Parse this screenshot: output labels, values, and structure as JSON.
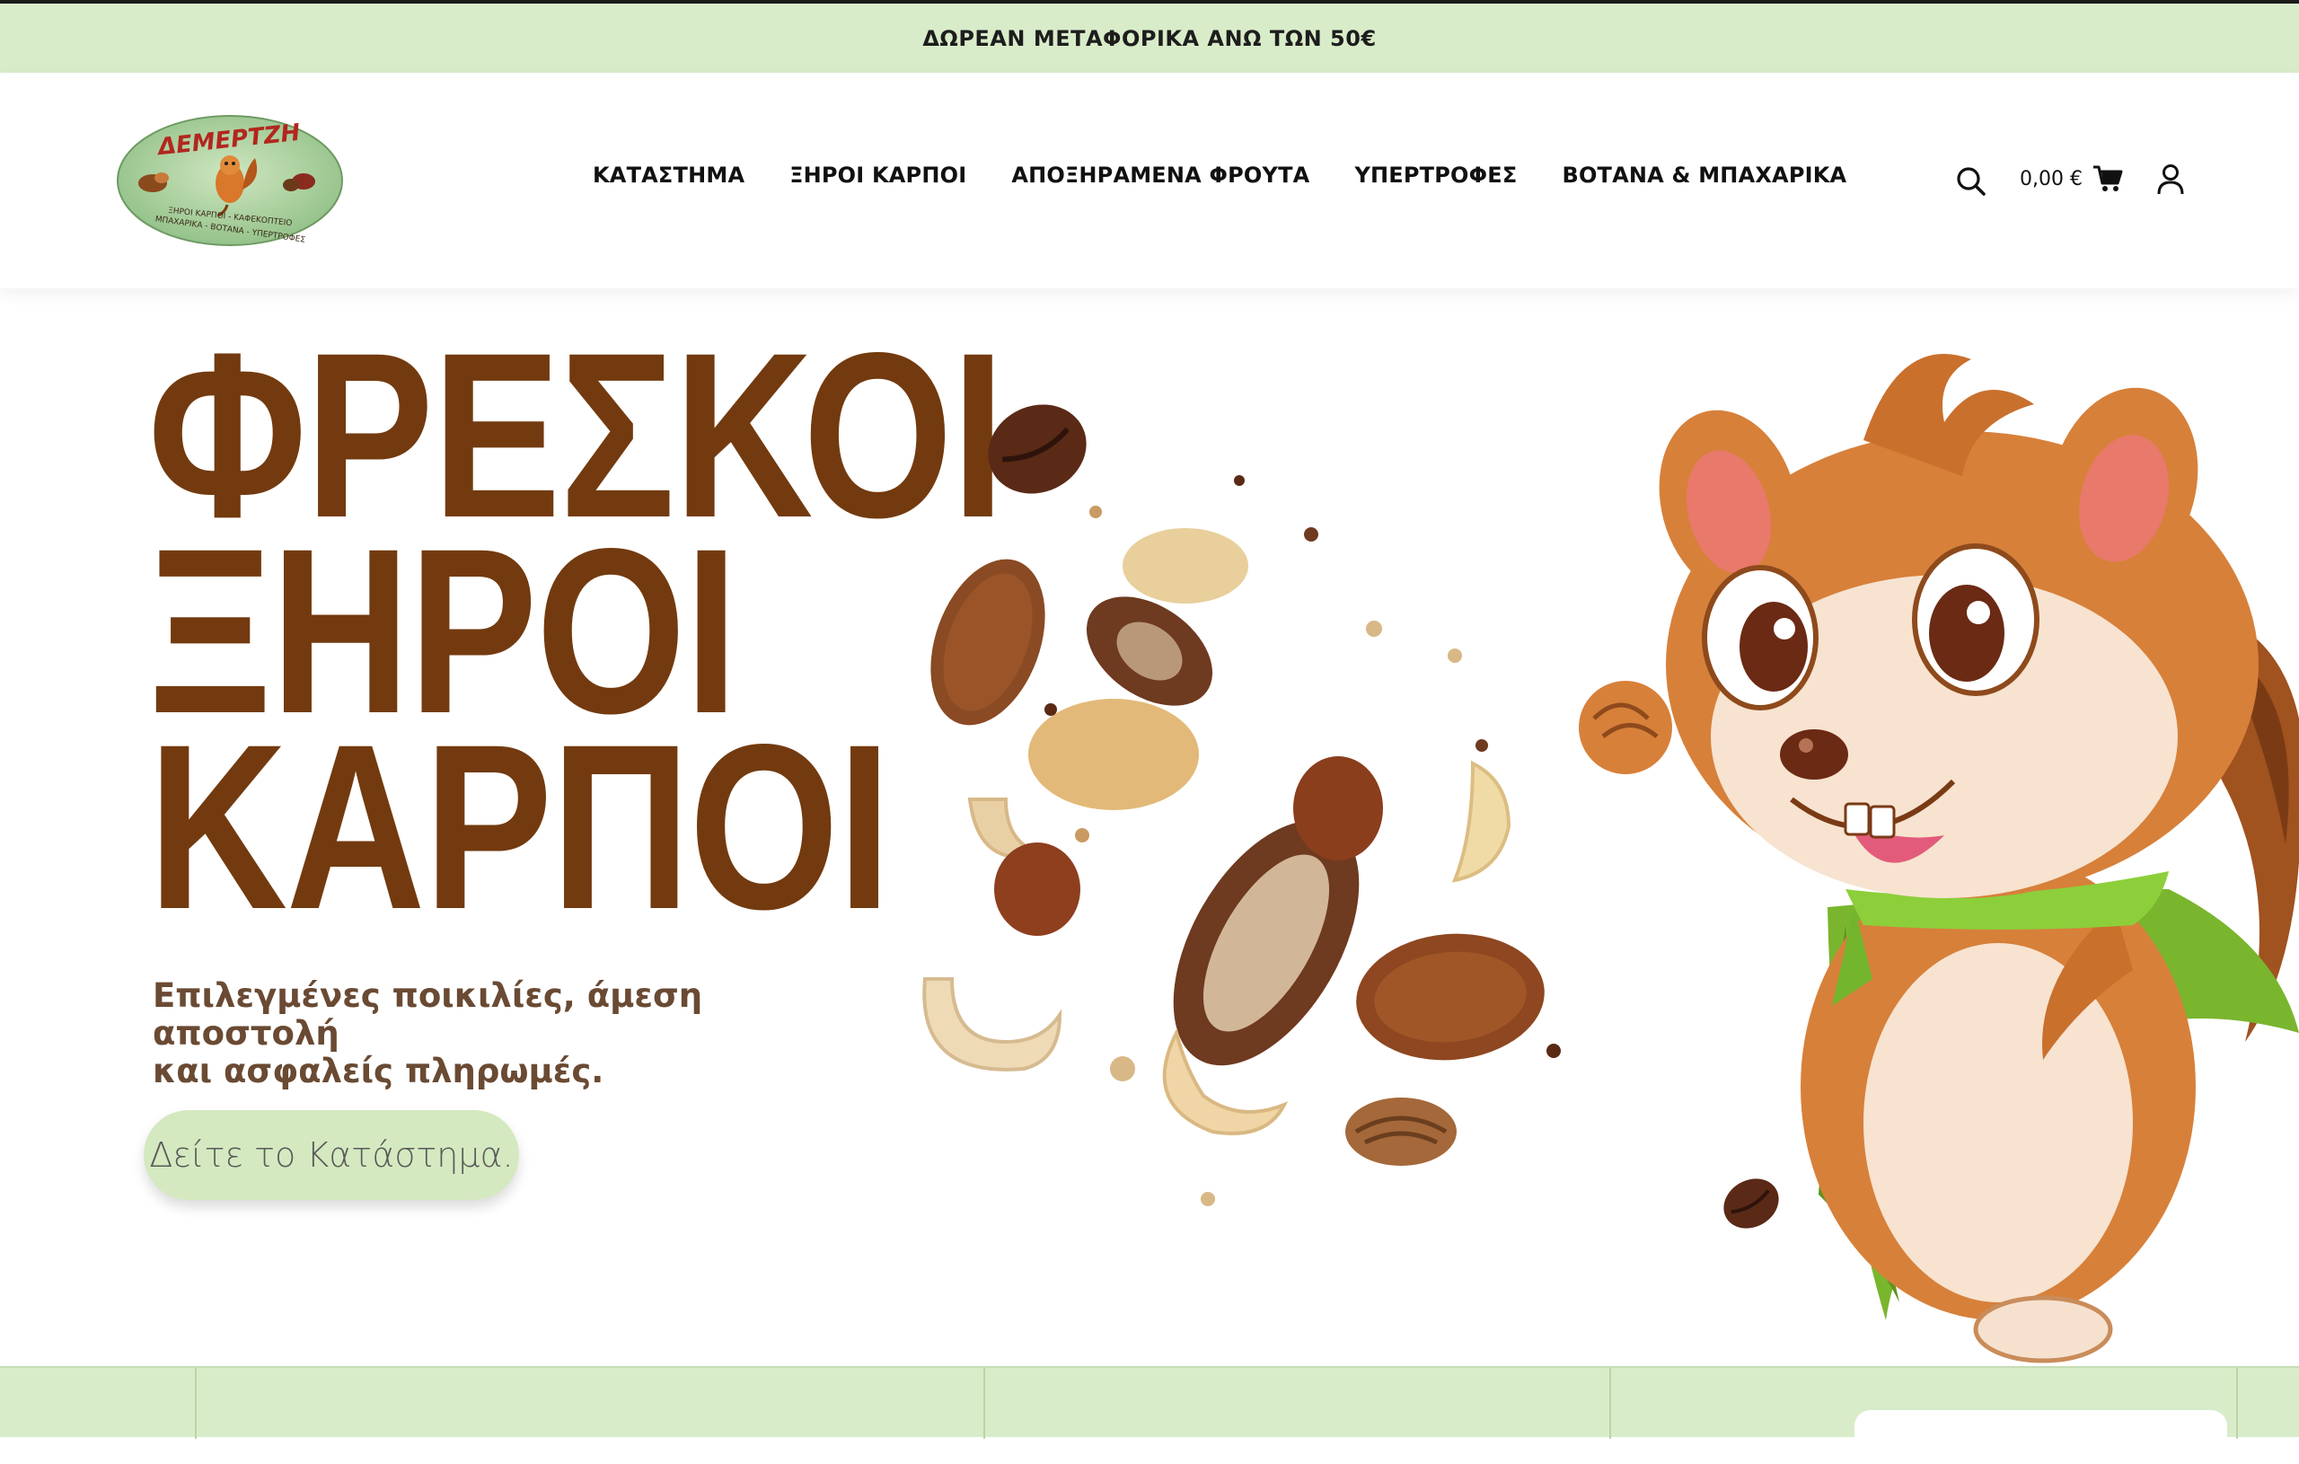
{
  "promo_bar": {
    "text": "ΔΩΡΕΑΝ ΜΕΤΑΦΟΡΙΚΑ ΑΝΩ ΤΩΝ 50€"
  },
  "logo": {
    "brand": "ΔΕΜΕΡΤΖΗ",
    "line1": "ΞΗΡΟΙ ΚΑΡΠΟΙ - ΚΑΦΕΚΟΠΤΕΙΟ",
    "line2": "ΜΠΑΧΑΡΙΚΑ - ΒΟΤΑΝΑ - ΥΠΕΡΤΡΟΦΕΣ"
  },
  "nav": {
    "items": [
      {
        "label": "ΚΑΤΑΣΤΗΜΑ"
      },
      {
        "label": "ΞΗΡΟΙ ΚΑΡΠΟΙ"
      },
      {
        "label": "ΑΠΟΞΗΡΑΜΕΝΑ ΦΡΟΥΤΑ"
      },
      {
        "label": "ΥΠΕΡΤΡΟΦΕΣ"
      },
      {
        "label": "ΒΟΤΑΝΑ & ΜΠΑΧΑΡΙΚΑ"
      }
    ]
  },
  "header_actions": {
    "cart_total": "0,00 €",
    "icons": [
      "search-icon",
      "cart-icon",
      "account-icon"
    ]
  },
  "hero": {
    "title_line1": "ΦΡΕΣΚΟΙ",
    "title_line2": "ΞΗΡΟΙ",
    "title_line3": "ΚΑΡΠΟΙ",
    "subtitle_line1": "Επιλεγμένες ποικιλίες, άμεση αποστολή",
    "subtitle_line2": "και ασφαλείς πληρωμές.",
    "cta_label": "Δείτε το Κατάστημα."
  },
  "colors": {
    "promo_bg": "#d9ecc9",
    "title_brown": "#733a0f",
    "subtitle_brown": "#6a4a33",
    "cta_bg": "#d4e9c0"
  }
}
